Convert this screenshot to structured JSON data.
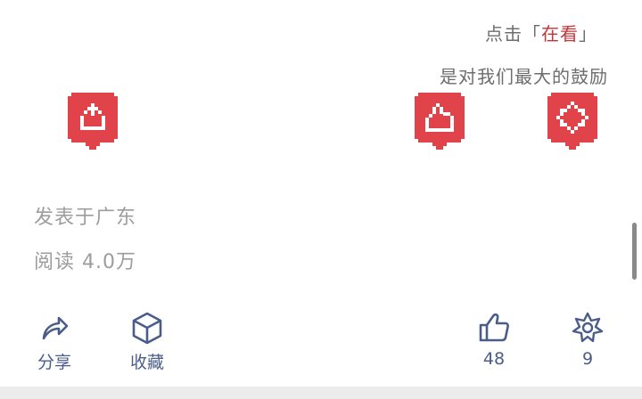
{
  "prompt": {
    "prefix": "点击「",
    "highlight": "在看",
    "suffix": "」",
    "line2": "是对我们最大的鼓励"
  },
  "meta": {
    "location": "发表于广东",
    "reads_label": "阅读",
    "reads_value": "4.0万"
  },
  "actions": {
    "share": "分享",
    "favorite": "收藏",
    "like_count": "48",
    "wow_count": "9"
  },
  "colors": {
    "accent_red": "#e1434b",
    "prompt_highlight": "#c4353a",
    "action_blue": "#4a5d8a",
    "meta_gray": "#9d9d9d"
  },
  "icons": {
    "badge_left": "share-pixel-icon",
    "badge_middle": "like-pixel-icon",
    "badge_right": "wow-pixel-icon",
    "share": "share-arrow-icon",
    "favorite": "cube-icon",
    "like": "thumbs-up-icon",
    "wow": "star-flower-icon"
  }
}
